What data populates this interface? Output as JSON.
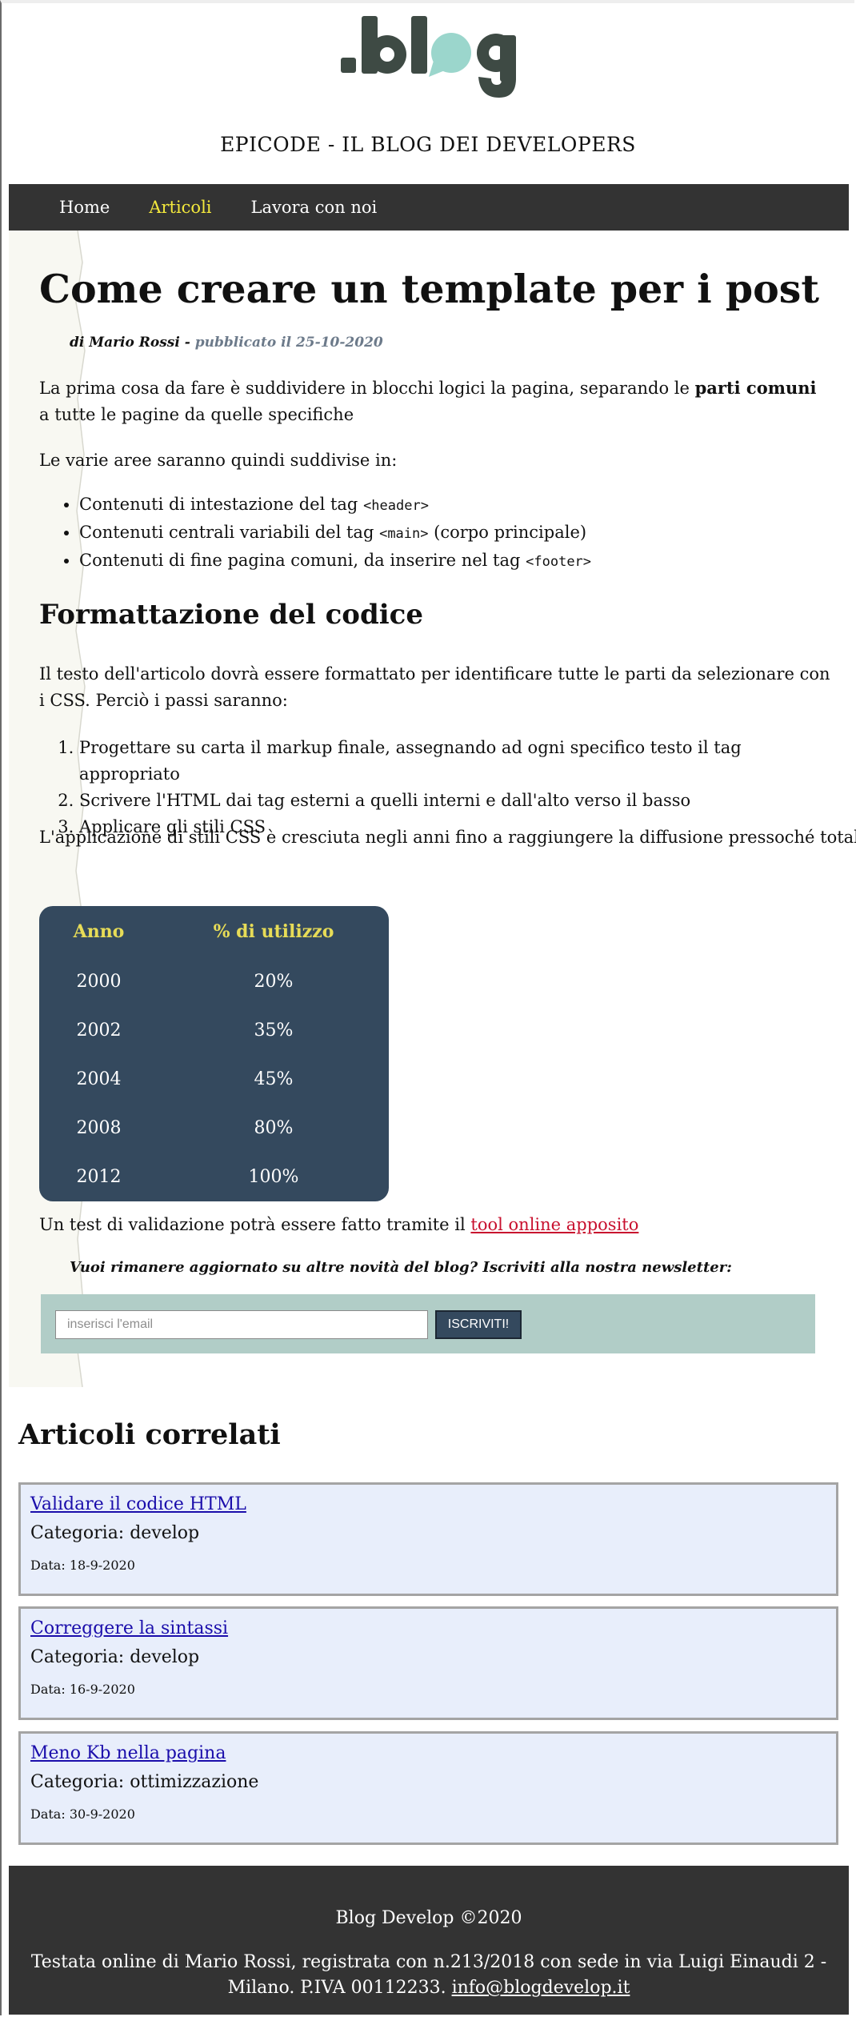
{
  "header": {
    "logo_text": ".blog",
    "site_title": "EPICODE - IL BLOG DEI DEVELOPERS",
    "colors": {
      "logo_dark": "#3e4a44",
      "logo_accent": "#9bd6cc"
    }
  },
  "nav": {
    "items": [
      {
        "label": "Home",
        "active": false
      },
      {
        "label": "Articoli",
        "active": true
      },
      {
        "label": "Lavora con noi",
        "active": false
      }
    ]
  },
  "article": {
    "title": "Come creare un template per i post",
    "byline_author": "di Mario Rossi - ",
    "byline_date": "pubblicato il 25-10-2020",
    "intro_before": "La prima cosa da fare è suddividere in blocchi logici la pagina, separando le ",
    "intro_bold": "parti comuni",
    "intro_after": " a tutte le pagine da quelle specifiche",
    "areas_intro": "Le varie aree saranno quindi suddivise in:",
    "areas": [
      {
        "before": "Contenuti di intestazione del tag ",
        "code": "<header>",
        "after": ""
      },
      {
        "before": "Contenuti centrali variabili del tag ",
        "code": "<main>",
        "after": " (corpo principale)"
      },
      {
        "before": "Contenuti di fine pagina comuni, da inserire nel tag ",
        "code": "<footer>",
        "after": ""
      }
    ],
    "section_title": "Formattazione del codice",
    "format_text": "Il testo dell'articolo dovrà essere formattato per identificare tutte le parti da selezionare con i CSS. Perciò i passi saranno:",
    "steps": [
      "Progettare su carta il markup finale, assegnando ad ogni specifico testo il tag appropriato",
      "Scrivere l'HTML dai tag esterni a quelli interni e dall'alto verso il basso",
      "Applicare gli stili CSS"
    ],
    "css_growth": "L'applicazione di stili CSS è cresciuta negli anni fino a raggiungere la diffusione pressoché totale",
    "table": {
      "headers": [
        "Anno",
        "% di utilizzo"
      ],
      "rows": [
        [
          "2000",
          "20%"
        ],
        [
          "2002",
          "35%"
        ],
        [
          "2004",
          "45%"
        ],
        [
          "2008",
          "80%"
        ],
        [
          "2012",
          "100%"
        ]
      ]
    },
    "validation_before": "Un test di validazione potrà essere fatto tramite il ",
    "validation_link": "tool online apposito",
    "newsletter_text": "Vuoi rimanere aggiornato su altre novità del blog? Iscriviti alla nostra newsletter:",
    "email_placeholder": "inserisci l'email",
    "subscribe_label": "ISCRIVITI!"
  },
  "related": {
    "title": "Articoli correlati",
    "cards": [
      {
        "link": "Validare il codice HTML",
        "category": "Categoria: develop",
        "date": "Data: 18-9-2020"
      },
      {
        "link": "Correggere la sintassi",
        "category": "Categoria: develop",
        "date": "Data: 16-9-2020"
      },
      {
        "link": "Meno Kb nella pagina",
        "category": "Categoria: ottimizzazione",
        "date": "Data: 30-9-2020"
      }
    ]
  },
  "footer": {
    "copyright": "Blog Develop ©2020",
    "info": "Testata online di Mario Rossi, registrata con n.213/2018 con sede in via Luigi Einaudi 2 - Milano. P.IVA 00112233. ",
    "email": "info@blogdevelop.it"
  }
}
